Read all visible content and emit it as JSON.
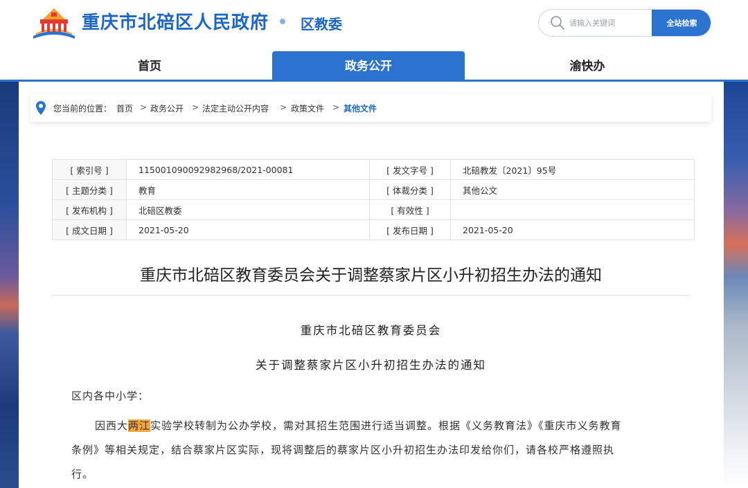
{
  "header": {
    "site_title": "重庆市北碚区人民政府",
    "sub_title": "区教委",
    "search_placeholder": "请输入关键词",
    "search_button": "全站检索"
  },
  "nav": {
    "items": [
      {
        "label": "首页"
      },
      {
        "label": "政务公开"
      },
      {
        "label": "渝快办"
      }
    ],
    "active": "政务公开"
  },
  "breadcrumb": {
    "prefix": "您当前的位置：",
    "items": [
      "首页",
      "政务公开",
      "法定主动公开内容",
      "政策文件",
      "其他文件"
    ],
    "separator": ">"
  },
  "meta": {
    "rows": [
      {
        "label1": "[ 索引号 ]",
        "value1": "11500109009298296​8/2021-00081",
        "label2": "[ 发文字号 ]",
        "value2": "北碚教发〔2021〕95号"
      },
      {
        "label1": "[ 主题分类 ]",
        "value1": "教育",
        "label2": "[ 体裁分类 ]",
        "value2": "其他公文"
      },
      {
        "label1": "[ 发布机构 ]",
        "value1": "北碚区教委",
        "label2": "[ 有效性 ]",
        "value2": ""
      },
      {
        "label1": "[ 成文日期 ]",
        "value1": "2021-05-20",
        "label2": "[ 发布日期 ]",
        "value2": "2021-05-20"
      }
    ]
  },
  "article": {
    "title": "重庆市北碚区教育委员会关于调整蔡家片区小升初招生办法的通知",
    "heading1": "重庆市北碚区教育委员会",
    "heading2": "关于调整蔡家片区小升初招生办法的通知",
    "salutation": "区内各中小学：",
    "para_prefix": "因西大",
    "para_highlight": "两江",
    "para_line1_rest": "实验学校转制为公办学校，需对其招生范围进行适当调整。根据《义务教育法》《重庆市义务教育",
    "para_line2": "条例》等相关规定，结合蔡家片区实际，现将调整后的蔡家片区小升初招生办法印发给你们，请各校严格遵照执",
    "para_line3": "行。"
  },
  "colors": {
    "brand_blue": "#1c67c6",
    "nav_active": "#2b73cf",
    "highlight": "#f9a63a"
  }
}
